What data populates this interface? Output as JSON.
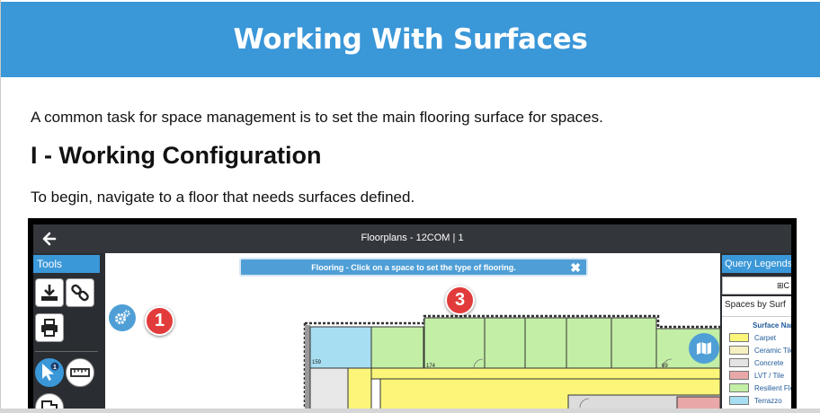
{
  "header": {
    "title": "Working With Surfaces"
  },
  "content": {
    "intro": "A common task for space management is to set the main flooring surface for spaces.",
    "section_heading": "I - Working Configuration",
    "instruction": "To begin, navigate to a floor that needs surfaces defined."
  },
  "app": {
    "title": "Floorplans - 12COM | 1",
    "tools_label": "Tools",
    "message": "Flooring - Click on a space to set the type of flooring.",
    "close_glyph": "✖",
    "tool_badge": "1",
    "callouts": [
      "1",
      "3"
    ],
    "room_numbers": [
      "159",
      "174",
      "69"
    ],
    "query_panel": {
      "tab_label": "Query Legends",
      "add_button": "⊞C",
      "legend_title": "Spaces by Surf",
      "column_header": "Surface Nam",
      "items": [
        {
          "label": "Carpet",
          "color": "#fbf57a"
        },
        {
          "label": "Ceramic Tile",
          "color": "#f6f0c0"
        },
        {
          "label": "Concrete",
          "color": "#e3e3e3"
        },
        {
          "label": "LVT / Tile",
          "color": "#e8a8a8"
        },
        {
          "label": "Resilient Flo",
          "color": "#c3eea6"
        },
        {
          "label": "Terrazzo",
          "color": "#a7def2"
        }
      ]
    }
  },
  "colors": {
    "banner": "#3a97d8",
    "accent": "#4f9fd6",
    "callout": "#e23b3b",
    "room_green": "#c3eea6",
    "room_blue": "#a7def2",
    "room_yellow": "#fbf57a",
    "room_pink": "#e8a8a8"
  }
}
